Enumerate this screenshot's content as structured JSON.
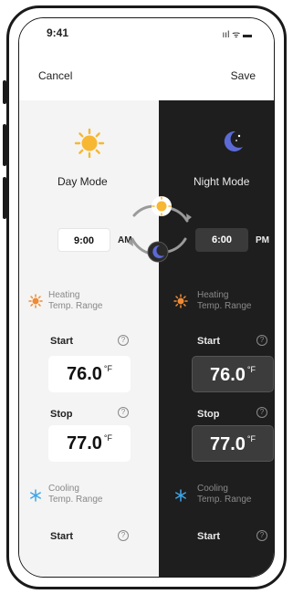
{
  "status": {
    "time": "9:41",
    "icons": "ııl ᯤ ▬"
  },
  "nav": {
    "cancel": "Cancel",
    "save": "Save"
  },
  "day": {
    "mode": "Day Mode",
    "time": "9:00",
    "period": "AM",
    "heating_title_1": "Heating",
    "heating_title_2": "Temp. Range",
    "start_label": "Start",
    "start_value": "76.0",
    "stop_label": "Stop",
    "stop_value": "77.0",
    "unit": "°F",
    "cooling_title_1": "Cooling",
    "cooling_title_2": "Temp. Range",
    "cooling_start_label": "Start",
    "help": "?"
  },
  "night": {
    "mode": "Night Mode",
    "time": "6:00",
    "period": "PM",
    "heating_title_1": "Heating",
    "heating_title_2": "Temp. Range",
    "start_label": "Start",
    "start_value": "76.0",
    "stop_label": "Stop",
    "stop_value": "77.0",
    "unit": "°F",
    "cooling_title_1": "Cooling",
    "cooling_title_2": "Temp. Range",
    "cooling_start_label": "Start",
    "help": "?"
  },
  "colors": {
    "sun": "#f7b733",
    "moon": "#5c6ad6",
    "heat": "#f08a34",
    "cool": "#3da6e8"
  }
}
